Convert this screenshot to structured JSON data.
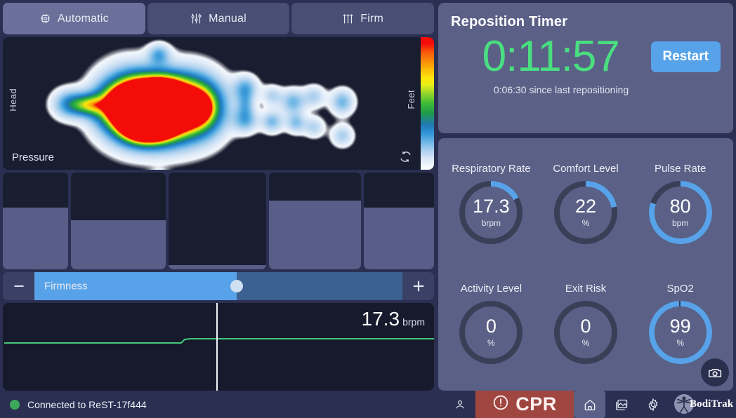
{
  "tabs": [
    {
      "label": "Automatic",
      "icon": "chip-icon",
      "active": true
    },
    {
      "label": "Manual",
      "icon": "sliders-icon",
      "active": false
    },
    {
      "label": "Firm",
      "icon": "firmness-icon",
      "active": false
    }
  ],
  "pressure_map": {
    "title": "Pressure",
    "head_label": "Head",
    "feet_label": "Feet",
    "refresh_icon": "rotate-icon",
    "colorbar": {
      "top_color": "#f30c08",
      "bottom_color": "#ffffff",
      "scale": "jet"
    }
  },
  "zones": [
    {
      "name": "zone-1",
      "fill_percent": 64,
      "width_percent": 15.5
    },
    {
      "name": "zone-2",
      "fill_percent": 51,
      "width_percent": 22.6
    },
    {
      "name": "zone-3",
      "fill_percent": 4,
      "width_percent": 23.2
    },
    {
      "name": "zone-4",
      "fill_percent": 71,
      "width_percent": 22.0
    },
    {
      "name": "zone-5",
      "fill_percent": 64,
      "width_percent": 16.7
    }
  ],
  "firmness": {
    "label": "Firmness",
    "value_percent": 55,
    "decrease_label": "−",
    "increase_label": "+"
  },
  "waveform": {
    "value": "17.3",
    "unit": "brpm",
    "line_color": "#46c878",
    "cursor_position_percent": 49.5
  },
  "timer": {
    "title": "Reposition Timer",
    "value": "0:11:57",
    "value_color": "#4ade80",
    "restart_label": "Restart",
    "subtitle": "0:06:30 since last repositioning"
  },
  "vitals": {
    "accent_color": "#57a2e8",
    "track_color": "#3a3f58",
    "rows": [
      [
        {
          "label": "Respiratory Rate",
          "value": "17.3",
          "unit": "brpm",
          "percent": 17
        },
        {
          "label": "Comfort Level",
          "value": "22",
          "unit": "%",
          "percent": 22
        },
        {
          "label": "Pulse Rate",
          "value": "80",
          "unit": "bpm",
          "percent": 80
        }
      ],
      [
        {
          "label": "Activity Level",
          "value": "0",
          "unit": "%",
          "percent": 0
        },
        {
          "label": "Exit Risk",
          "value": "0",
          "unit": "%",
          "percent": 0
        },
        {
          "label": "SpO2",
          "value": "99",
          "unit": "%",
          "percent": 99
        }
      ]
    ],
    "camera_icon": "camera-icon"
  },
  "statusbar": {
    "connection_text": "Connected to ReST-17f444",
    "connection_color": "#3da85a",
    "cpr_label": "CPR",
    "cpr_color": "#a04641",
    "icons": [
      {
        "name": "person-icon",
        "active": false
      },
      {
        "name": "home-icon",
        "active": true
      },
      {
        "name": "gallery-icon",
        "active": false
      },
      {
        "name": "gear-icon",
        "active": false
      }
    ],
    "brand_name": "BodiTrak"
  }
}
